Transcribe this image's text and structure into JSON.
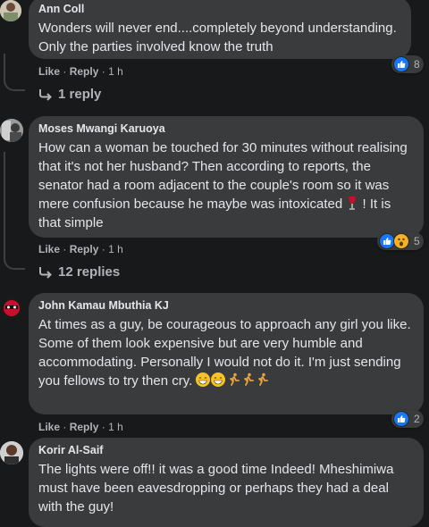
{
  "comments": [
    {
      "author": "Ann Coll",
      "text": "Wonders will never end....completely beyond understanding. Only the parties involved know the truth",
      "like_label": "Like",
      "reply_label": "Reply",
      "time": "1 h",
      "reaction_count": "8",
      "reactions": [
        "like-icon"
      ]
    },
    {
      "author": "Moses Mwangi Karuoya",
      "text_main": "How can a woman be touched for 30 minutes without realising that it's not her husband? Then according to reports, the senator had a room adjacent to the couple's room so it was mere confusion because he maybe was intoxicated",
      "text_tail": "! It is that simple",
      "like_label": "Like",
      "reply_label": "Reply",
      "time": "1 h",
      "reaction_count": "5",
      "reactions": [
        "like-icon",
        "wow-icon"
      ]
    },
    {
      "author": "John Kamau Mbuthia KJ",
      "text": "At times as a guy, be courageous to approach any girl you like. Some of them look expensive but are very humble and accommodating. Personally I would not do it. I'm just sending you fellows to try then cry.",
      "like_label": "Like",
      "reply_label": "Reply",
      "time": "1 h",
      "reaction_count": "2",
      "reactions": [
        "like-icon"
      ]
    },
    {
      "author": "Korir Al-Saif",
      "text": "The lights were off!! it was a good time Indeed! Mheshimiwa must have been eavesdropping or perhaps they had a deal with the guy!"
    }
  ],
  "reply_links": [
    {
      "label": "1 reply"
    },
    {
      "label": "12 replies"
    }
  ],
  "separator": "·",
  "colors": {
    "background": "#18191a",
    "bubble": "#3a3b3c",
    "like_blue": "#1877f2",
    "muted": "#b0b3b8"
  }
}
